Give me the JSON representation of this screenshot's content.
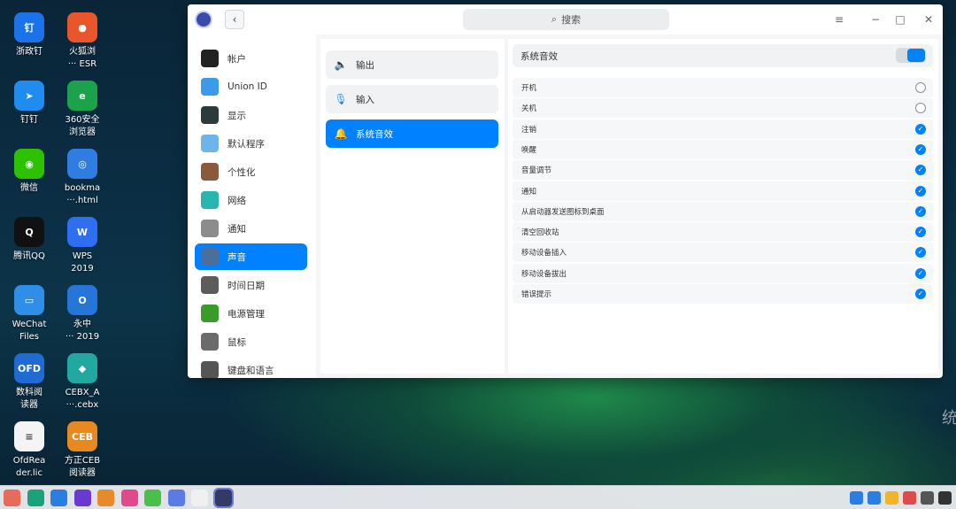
{
  "desktop": {
    "icons": [
      {
        "label": "浙政钉",
        "color": "#1a73e8",
        "glyph": "钉"
      },
      {
        "label": "火狐浏\n··· ESR",
        "color": "#e8562a",
        "glyph": "●"
      },
      {
        "label": "钉钉",
        "color": "#1f8cf0",
        "glyph": "➤"
      },
      {
        "label": "360安全\n浏览器",
        "color": "#1aa34a",
        "glyph": "e"
      },
      {
        "label": "微信",
        "color": "#2dc100",
        "glyph": "◉"
      },
      {
        "label": "bookma\n···.html",
        "color": "#2f7de1",
        "glyph": "◎"
      },
      {
        "label": "腾讯QQ",
        "color": "#111111",
        "glyph": "Q"
      },
      {
        "label": "WPS\n2019",
        "color": "#2d6ff0",
        "glyph": "W"
      },
      {
        "label": "WeChat\nFiles",
        "color": "#2f8fe8",
        "glyph": "▭"
      },
      {
        "label": "永中\n··· 2019",
        "color": "#2676d9",
        "glyph": "O"
      },
      {
        "label": "数科阅\n读器",
        "color": "#1d6bd3",
        "glyph": "OFD"
      },
      {
        "label": "CEBX_A\n···.cebx",
        "color": "#21a8a0",
        "glyph": "◆"
      },
      {
        "label": "OfdRea\nder.lic",
        "color": "#f4f4f4",
        "glyph": "≡"
      },
      {
        "label": "方正CEB\n阅读器",
        "color": "#e8891f",
        "glyph": "CEB"
      }
    ],
    "watermark": "统"
  },
  "window": {
    "back_glyph": "‹",
    "search": {
      "icon": "search-icon",
      "glyph": "⌕",
      "label": "搜索"
    },
    "controls": {
      "menu": "≡",
      "minimize": "−",
      "maximize": "□",
      "close": "✕"
    },
    "sidebar": [
      {
        "label": "帐户",
        "color": "#222222"
      },
      {
        "label": "Union ID",
        "color": "#3b9be8"
      },
      {
        "label": "显示",
        "color": "#2b3a3a"
      },
      {
        "label": "默认程序",
        "color": "#6fb4e8"
      },
      {
        "label": "个性化",
        "color": "#8a5a3a"
      },
      {
        "label": "网络",
        "color": "#2ab6b0"
      },
      {
        "label": "通知",
        "color": "#8c8c8c"
      },
      {
        "label": "声音",
        "color": "#4b6f9a"
      },
      {
        "label": "时间日期",
        "color": "#5c5c5c"
      },
      {
        "label": "电源管理",
        "color": "#3a9b2a"
      },
      {
        "label": "鼠标",
        "color": "#6b6b6b"
      },
      {
        "label": "键盘和语言",
        "color": "#555555"
      }
    ],
    "sidebar_active": 7,
    "middle": [
      {
        "label": "输出",
        "glyph": "🔈"
      },
      {
        "label": "输入",
        "glyph": "🎙"
      },
      {
        "label": "系统音效",
        "glyph": "🔔"
      }
    ],
    "middle_active": 2,
    "content": {
      "section_title": "系统音效",
      "toggle_on": true,
      "rows": [
        {
          "label": "开机",
          "checked": false
        },
        {
          "label": "关机",
          "checked": false
        },
        {
          "label": "注销",
          "checked": true
        },
        {
          "label": "唤醒",
          "checked": true
        },
        {
          "label": "音量调节",
          "checked": true
        },
        {
          "label": "通知",
          "checked": true
        },
        {
          "label": "从启动器发送图标到桌面",
          "checked": true
        },
        {
          "label": "清空回收站",
          "checked": true
        },
        {
          "label": "移动设备插入",
          "checked": true
        },
        {
          "label": "移动设备拔出",
          "checked": true
        },
        {
          "label": "错误提示",
          "checked": true
        }
      ],
      "check_glyph": "✓"
    }
  },
  "taskbar": {
    "launcher_colors": [
      "#e86a5a",
      "#1aa37a",
      "#2a7de1",
      "#6a3ad0",
      "#e8892a",
      "#e04a8a",
      "#4ac04a",
      "#5a7ae8",
      "#f0f0f0",
      "#333a66"
    ],
    "tray_colors": [
      "#2a7de1",
      "#2a7de1",
      "#f0b52a",
      "#e04a4a",
      "#555555",
      "#333333"
    ]
  }
}
